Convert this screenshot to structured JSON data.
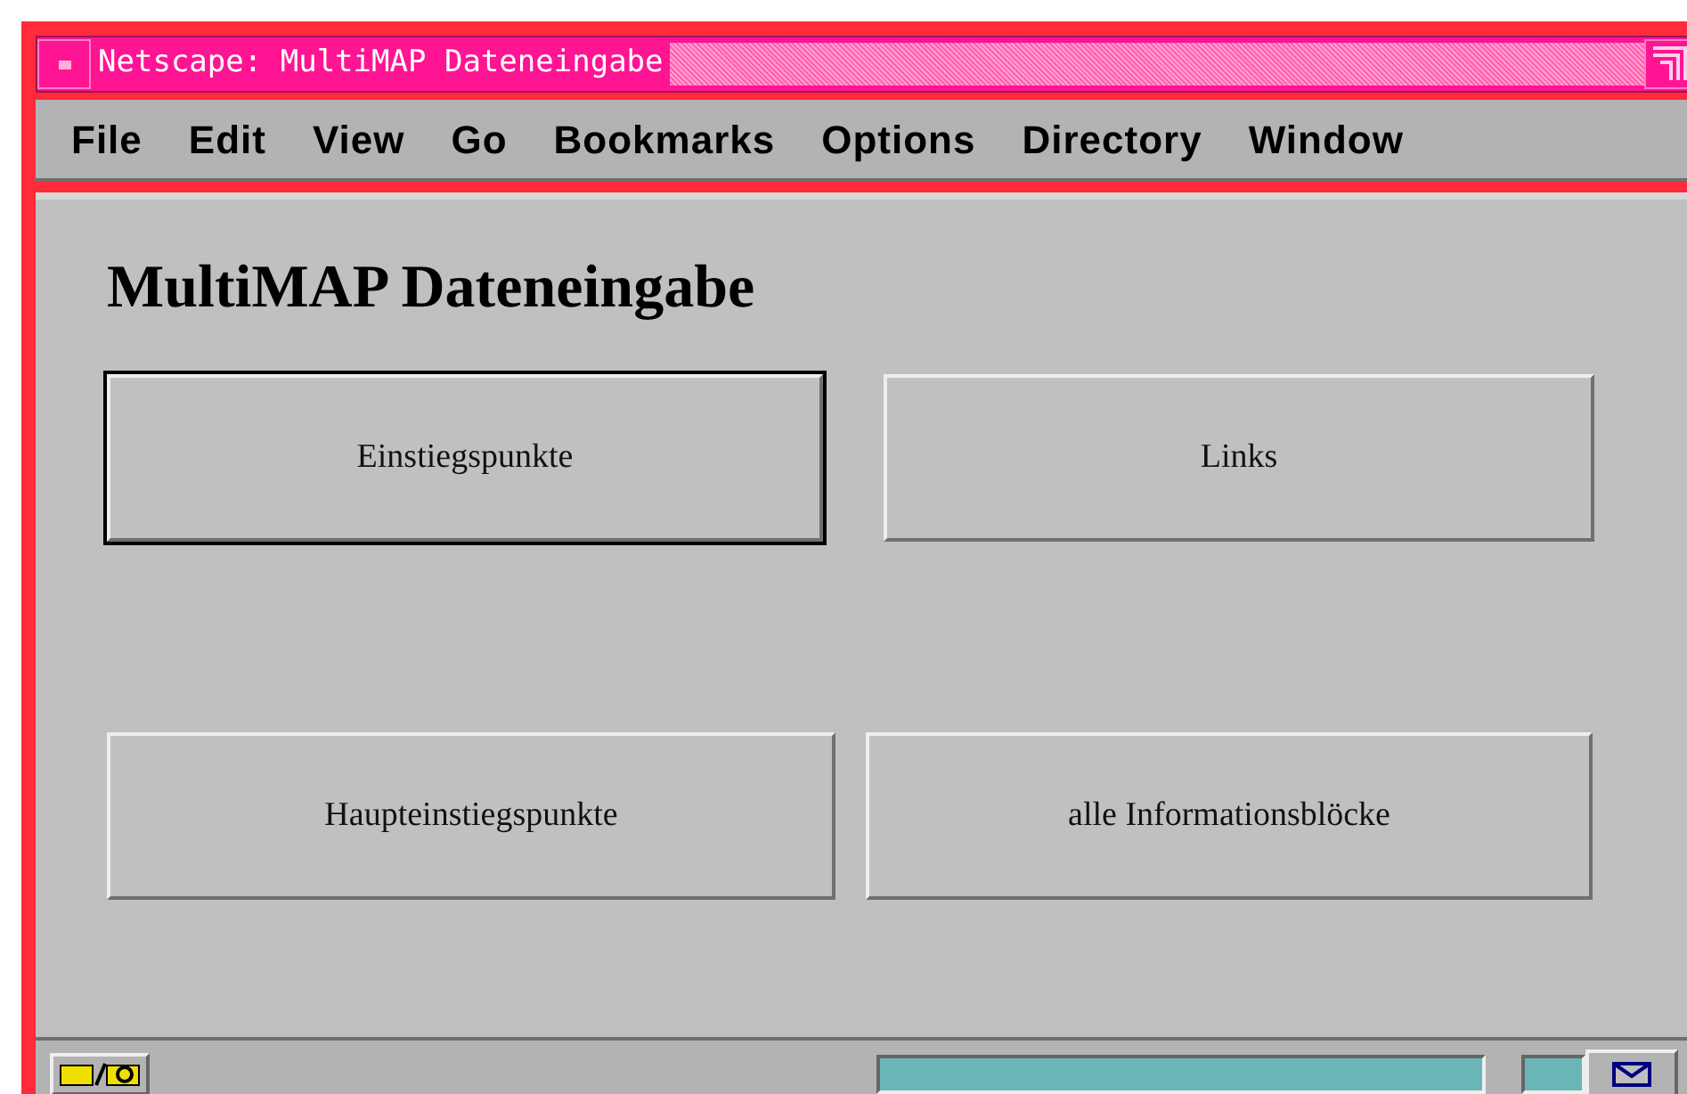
{
  "window": {
    "title": "Netscape: MultiMAP Dateneingabe"
  },
  "menu": [
    "File",
    "Edit",
    "View",
    "Go",
    "Bookmarks",
    "Options",
    "Directory",
    "Window"
  ],
  "heading": "MultiMAP Dateneingabe",
  "button_rows": [
    [
      {
        "label": "Einstiegspunkte",
        "focused": true
      },
      {
        "label": "Links",
        "focused": false
      }
    ],
    [
      {
        "label": "Haupteinstiegspunkte",
        "focused": false
      },
      {
        "label": "alle Informationsblöcke",
        "focused": false
      }
    ]
  ]
}
